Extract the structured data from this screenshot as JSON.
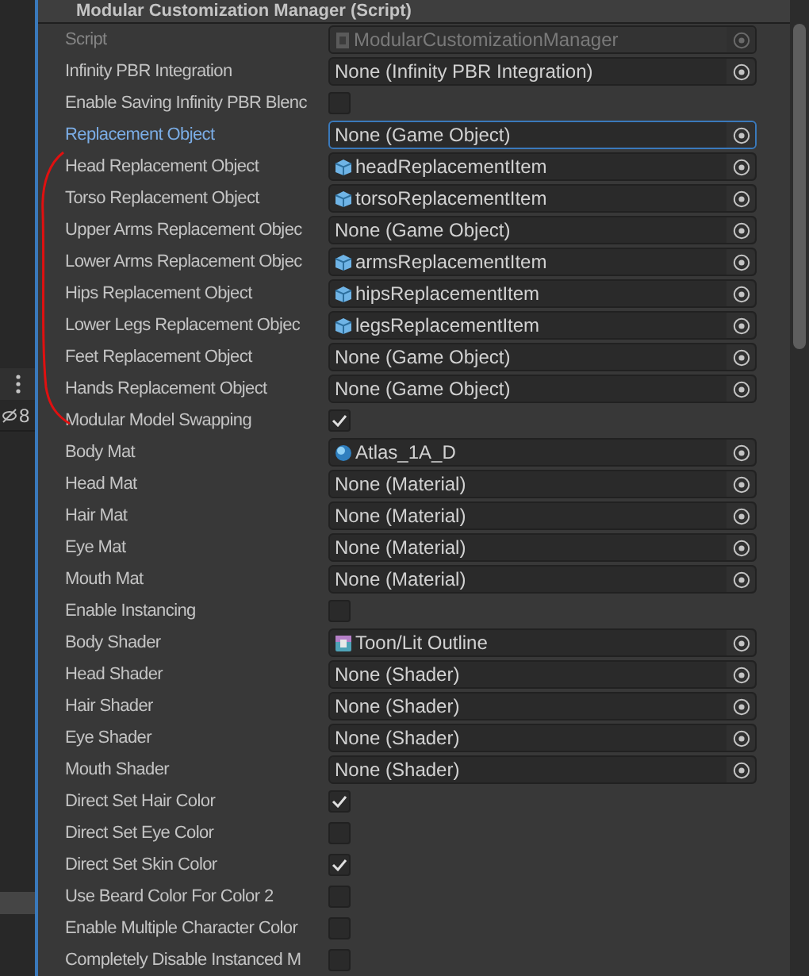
{
  "component": {
    "title": "Modular Customization Manager (Script)"
  },
  "side_panel": {
    "count": "8"
  },
  "rows": [
    {
      "label": "Script",
      "kind": "script_field",
      "value": "ModularCustomizationManager",
      "disabled": true,
      "selected": false
    },
    {
      "label": "Infinity PBR Integration",
      "kind": "object",
      "value": "None (Infinity PBR Integration)",
      "disabled": false,
      "selected": false
    },
    {
      "label": "Enable Saving Infinity PBR Blenc",
      "kind": "toggle",
      "checked": false,
      "disabled": false,
      "selected": false
    },
    {
      "label": "Replacement Object",
      "kind": "object",
      "value": "None (Game Object)",
      "disabled": false,
      "selected": true
    },
    {
      "label": "Head Replacement Object",
      "kind": "prefab_field",
      "value": "headReplacementItem",
      "disabled": false,
      "selected": false
    },
    {
      "label": "Torso Replacement Object",
      "kind": "prefab_field",
      "value": "torsoReplacementItem",
      "disabled": false,
      "selected": false
    },
    {
      "label": "Upper Arms Replacement Objec",
      "kind": "object",
      "value": "None (Game Object)",
      "disabled": false,
      "selected": false
    },
    {
      "label": "Lower Arms Replacement Objec",
      "kind": "prefab_field",
      "value": "armsReplacementItem",
      "disabled": false,
      "selected": false
    },
    {
      "label": "Hips Replacement Object",
      "kind": "prefab_field",
      "value": "hipsReplacementItem",
      "disabled": false,
      "selected": false
    },
    {
      "label": "Lower Legs Replacement Objec",
      "kind": "prefab_field",
      "value": "legsReplacementItem",
      "disabled": false,
      "selected": false
    },
    {
      "label": "Feet Replacement Object",
      "kind": "object",
      "value": "None (Game Object)",
      "disabled": false,
      "selected": false
    },
    {
      "label": "Hands Replacement Object",
      "kind": "object",
      "value": "None (Game Object)",
      "disabled": false,
      "selected": false
    },
    {
      "label": "Modular Model Swapping",
      "kind": "toggle",
      "checked": true,
      "disabled": false,
      "selected": false
    },
    {
      "label": "Body Mat",
      "kind": "material_field",
      "value": "Atlas_1A_D",
      "disabled": false,
      "selected": false
    },
    {
      "label": "Head Mat",
      "kind": "object",
      "value": "None (Material)",
      "disabled": false,
      "selected": false
    },
    {
      "label": "Hair Mat",
      "kind": "object",
      "value": "None (Material)",
      "disabled": false,
      "selected": false
    },
    {
      "label": "Eye Mat",
      "kind": "object",
      "value": "None (Material)",
      "disabled": false,
      "selected": false
    },
    {
      "label": "Mouth Mat",
      "kind": "object",
      "value": "None (Material)",
      "disabled": false,
      "selected": false
    },
    {
      "label": "Enable Instancing",
      "kind": "toggle",
      "checked": false,
      "disabled": false,
      "selected": false
    },
    {
      "label": "Body Shader",
      "kind": "shader_field",
      "value": "Toon/Lit Outline",
      "disabled": false,
      "selected": false
    },
    {
      "label": "Head Shader",
      "kind": "object",
      "value": "None (Shader)",
      "disabled": false,
      "selected": false
    },
    {
      "label": "Hair Shader",
      "kind": "object",
      "value": "None (Shader)",
      "disabled": false,
      "selected": false
    },
    {
      "label": "Eye Shader",
      "kind": "object",
      "value": "None (Shader)",
      "disabled": false,
      "selected": false
    },
    {
      "label": "Mouth Shader",
      "kind": "object",
      "value": "None (Shader)",
      "disabled": false,
      "selected": false
    },
    {
      "label": "Direct Set Hair Color",
      "kind": "toggle",
      "checked": true,
      "disabled": false,
      "selected": false
    },
    {
      "label": "Direct Set Eye Color",
      "kind": "toggle",
      "checked": false,
      "disabled": false,
      "selected": false
    },
    {
      "label": "Direct Set Skin Color",
      "kind": "toggle",
      "checked": true,
      "disabled": false,
      "selected": false
    },
    {
      "label": "Use Beard Color For Color 2",
      "kind": "toggle",
      "checked": false,
      "disabled": false,
      "selected": false
    },
    {
      "label": "Enable Multiple Character Color",
      "kind": "toggle",
      "checked": false,
      "disabled": false,
      "selected": false
    },
    {
      "label": "Completely Disable Instanced M",
      "kind": "toggle",
      "checked": false,
      "disabled": false,
      "selected": false
    }
  ]
}
